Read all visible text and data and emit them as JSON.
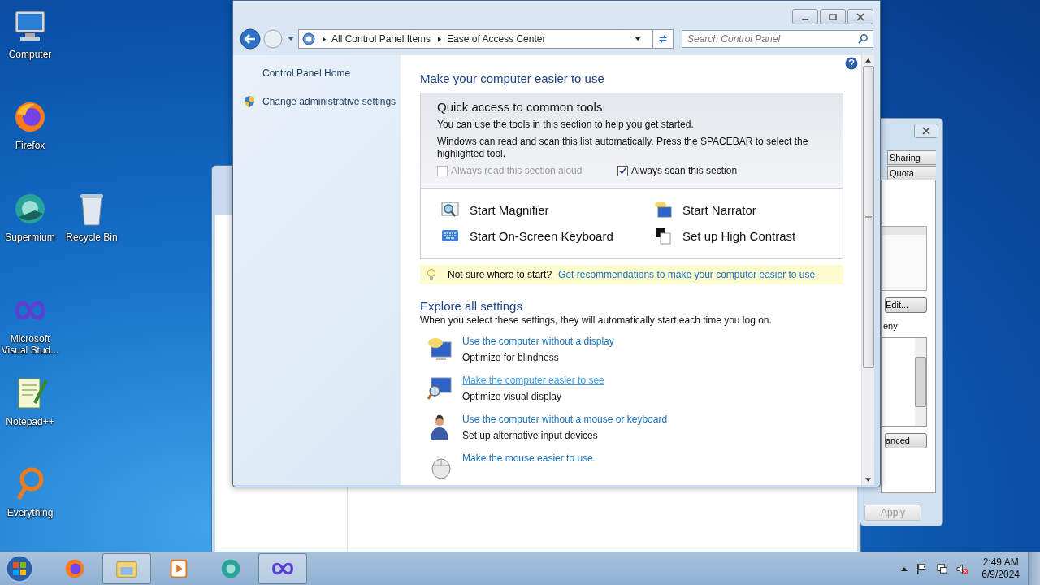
{
  "desktop_icons": [
    {
      "label": "Computer",
      "kind": "computer"
    },
    {
      "label": "Firefox",
      "kind": "firefox"
    },
    {
      "label": "Supermium",
      "kind": "supermium"
    },
    {
      "label": "Recycle Bin",
      "kind": "recycle"
    },
    {
      "label": "Microsoft Visual Stud...",
      "kind": "vstudio"
    },
    {
      "label": "Notepad++",
      "kind": "notepad"
    },
    {
      "label": "Everything",
      "kind": "everything"
    }
  ],
  "properties_dialog": {
    "tabs": [
      "Sharing",
      "Quota"
    ],
    "edit_button": "Edit...",
    "permissions_label": "eny",
    "advanced_button": "anced",
    "apply_button": {
      "label": "Apply",
      "disabled": true
    }
  },
  "main_window": {
    "address": {
      "crumbs": [
        "All Control Panel Items",
        "Ease of Access Center"
      ]
    },
    "search": {
      "placeholder": "Search Control Panel"
    },
    "sidebar": {
      "items": [
        {
          "label": "Control Panel Home",
          "kind": "plain"
        },
        {
          "label": "Change administrative settings",
          "kind": "shield"
        }
      ]
    },
    "content": {
      "title": "Make your computer easier to use",
      "quick_access": {
        "title": "Quick access to common tools",
        "description": "You can use the tools in this section to help you get started.",
        "note": "Windows can read and scan this list automatically.  Press the SPACEBAR to select the highlighted tool.",
        "checkboxes": [
          {
            "label": "Always read this section aloud",
            "checked": false,
            "disabled": true
          },
          {
            "label": "Always scan this section",
            "checked": true,
            "disabled": false
          }
        ],
        "tools": [
          {
            "label": "Start Magnifier",
            "kind": "magnifier"
          },
          {
            "label": "Start Narrator",
            "kind": "narrator"
          },
          {
            "label": "Start On-Screen Keyboard",
            "kind": "keyboard"
          },
          {
            "label": "Set up High Contrast",
            "kind": "contrast"
          }
        ]
      },
      "tip": {
        "prompt": "Not sure where to start?",
        "link": "Get recommendations to make your computer easier to use"
      },
      "explore": {
        "title": "Explore all settings",
        "description": "When you select these settings, they will automatically start each time you log on.",
        "items": [
          {
            "link": "Use the computer without a display",
            "description": "Optimize for blindness",
            "kind": "display",
            "hovered": false
          },
          {
            "link": "Make the computer easier to see",
            "description": "Optimize visual display",
            "kind": "see",
            "hovered": true
          },
          {
            "link": "Use the computer without a mouse or keyboard",
            "description": "Set up alternative input devices",
            "kind": "person",
            "hovered": false
          },
          {
            "link": "Make the mouse easier to use",
            "kind": "mouse",
            "hovered": false
          }
        ]
      }
    }
  },
  "taskbar": {
    "apps": [
      {
        "kind": "firefox",
        "active": false
      },
      {
        "kind": "explorer",
        "active": true
      },
      {
        "kind": "media",
        "active": false
      },
      {
        "kind": "supermium",
        "active": false
      },
      {
        "kind": "vstudio",
        "active": true
      }
    ],
    "time": "2:49 AM",
    "date": "6/9/2024"
  }
}
